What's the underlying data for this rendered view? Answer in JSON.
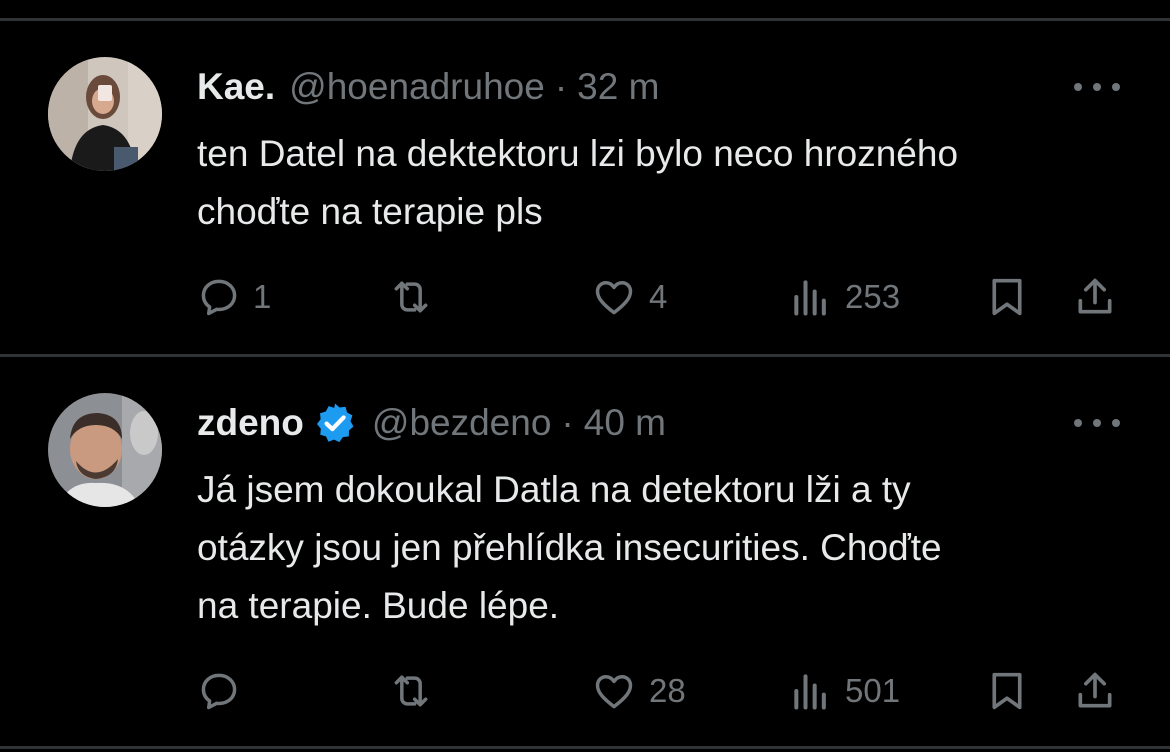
{
  "tweets": [
    {
      "name": "Kae.",
      "handle": "@hoenadruhoe",
      "separator": "·",
      "time": "32 m",
      "verified": false,
      "body_lines": [
        "ten Datel na dektektoru lzi bylo neco hrozného",
        "choďte na terapie pls"
      ],
      "replies": "1",
      "retweets": "",
      "likes": "4",
      "views": "253"
    },
    {
      "name": "zdeno",
      "handle": "@bezdeno",
      "separator": "·",
      "time": "40 m",
      "verified": true,
      "body_lines": [
        "Já jsem dokoukal Datla na detektoru lži a ty",
        "otázky jsou jen přehlídka insecurities. Choďte",
        "na terapie. Bude lépe."
      ],
      "replies": "",
      "retweets": "",
      "likes": "28",
      "views": "501"
    }
  ],
  "icons": {
    "reply": "reply-icon",
    "retweet": "retweet-icon",
    "like": "heart-icon",
    "views": "views-icon",
    "bookmark": "bookmark-icon",
    "share": "share-icon",
    "more": "more-icon",
    "verified": "verified-badge-icon"
  },
  "colors": {
    "background": "#000000",
    "text": "#e7e9ea",
    "secondary": "#71767b",
    "divider": "#2f3336",
    "verified": "#1d9bf0"
  }
}
